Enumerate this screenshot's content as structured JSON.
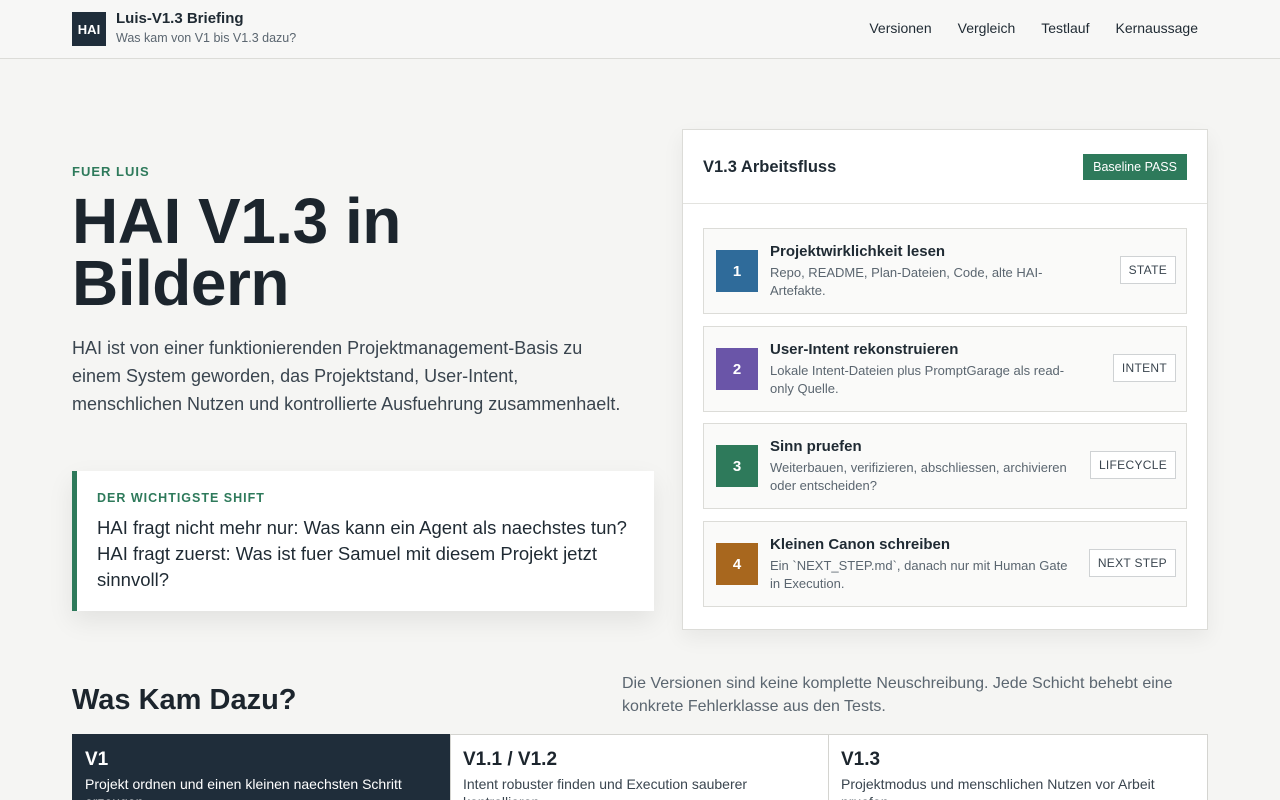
{
  "header": {
    "logo": "HAI",
    "title": "Luis-V1.3 Briefing",
    "subtitle": "Was kam von V1 bis V1.3 dazu?",
    "nav": [
      "Versionen",
      "Vergleich",
      "Testlauf",
      "Kernaussage"
    ]
  },
  "hero": {
    "eyebrow": "FUER LUIS",
    "title": "HAI V1.3 in Bildern",
    "text": "HAI ist von einer funktionierenden Projektmanagement-Basis zu einem System geworden, das Projektstand, User-Intent, menschlichen Nutzen und kontrollierte Ausfuehrung zusammenhaelt.",
    "shift_label": "DER WICHTIGSTE SHIFT",
    "shift_text": "HAI fragt nicht mehr nur: Was kann ein Agent als naechstes tun? HAI fragt zuerst: Was ist fuer Samuel mit diesem Projekt jetzt sinnvoll?"
  },
  "flow": {
    "title": "V1.3 Arbeitsfluss",
    "badge": "Baseline PASS",
    "steps": [
      {
        "num": "1",
        "title": "Projektwirklichkeit lesen",
        "desc": "Repo, README, Plan-Dateien, Code, alte HAI-Artefakte.",
        "tag": "STATE",
        "color": "#2f6b9a"
      },
      {
        "num": "2",
        "title": "User-Intent rekonstruieren",
        "desc": "Lokale Intent-Dateien plus PromptGarage als read-only Quelle.",
        "tag": "INTENT",
        "color": "#6a55a8"
      },
      {
        "num": "3",
        "title": "Sinn pruefen",
        "desc": "Weiterbauen, verifizieren, abschliessen, archivieren oder entscheiden?",
        "tag": "LIFECYCLE",
        "color": "#2e7a5b"
      },
      {
        "num": "4",
        "title": "Kleinen Canon schreiben",
        "desc": "Ein `NEXT_STEP.md`, danach nur mit Human Gate in Execution.",
        "tag": "NEXT STEP",
        "color": "#a8671e"
      }
    ]
  },
  "versions": {
    "title": "Was Kam Dazu?",
    "desc": "Die Versionen sind keine komplette Neuschreibung. Jede Schicht behebt eine konkrete Fehlerklasse aus den Tests.",
    "cards": [
      {
        "title": "V1",
        "desc": "Projekt ordnen und einen kleinen naechsten Schritt erzeugen"
      },
      {
        "title": "V1.1 / V1.2",
        "desc": "Intent robuster finden und Execution sauberer kontrollieren"
      },
      {
        "title": "V1.3",
        "desc": "Projektmodus und menschlichen Nutzen vor Arbeit pruefen"
      }
    ]
  }
}
